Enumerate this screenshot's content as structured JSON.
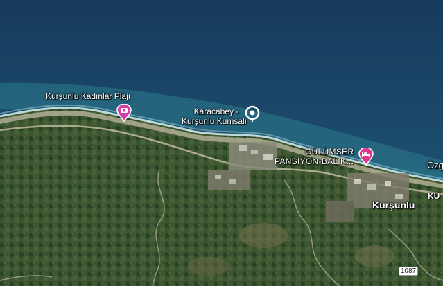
{
  "map": {
    "view": "satellite",
    "places": [
      {
        "id": "beach-women",
        "name": "Kurşunlu Kadınlar Plajı",
        "icon": "camera-pin-icon",
        "color": "#d63fa8"
      },
      {
        "id": "karacabey",
        "name_line1": "Karacabey -",
        "name_line2": "Kurşunlu Kumsalı",
        "icon": "location-circle-icon",
        "color": "#ffffff"
      },
      {
        "id": "gulumser",
        "name_line1": "GÜLÜMSER",
        "name_line2": "PANSİYON-BALIK...",
        "icon": "bed-pin-icon",
        "color": "#e0388f"
      },
      {
        "id": "town",
        "name": "Kurşunlu"
      },
      {
        "id": "edge-ozg",
        "name": "Özg"
      },
      {
        "id": "edge-ku",
        "name": "KU"
      }
    ],
    "road_number": "1087"
  }
}
